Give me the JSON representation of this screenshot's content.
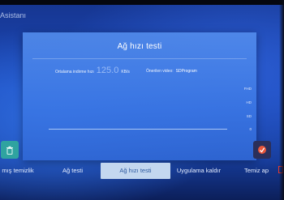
{
  "app": {
    "title": "Asistanı"
  },
  "dialog": {
    "title": "Ağ hızı testi",
    "average_speed_label": "Ortalama indirme hızı",
    "average_speed_value": "125.0",
    "average_speed_unit": "KB/s",
    "recommended_video_label": "Önerilen video:",
    "recommended_video_value": "SDProgram",
    "quality_levels": [
      "FHD",
      "HD",
      "SD",
      "0"
    ]
  },
  "taskbar": {
    "tabs": [
      {
        "label": "mış temizlik"
      },
      {
        "label": "Ağ testi"
      },
      {
        "label": "Ağ hızı testi",
        "selected": true
      },
      {
        "label": "Uygulama kaldır"
      },
      {
        "label": "Temiz ap"
      }
    ]
  },
  "icons": {
    "left_tile": "trash-icon",
    "right_tile": "cleaning-icon"
  },
  "colors": {
    "selected_tab_bg": "#c3d7ef",
    "selected_tab_text": "#2e5aa0",
    "dialog_bg": "#4a86e6",
    "left_tile_bg": "#2fa3a0"
  }
}
